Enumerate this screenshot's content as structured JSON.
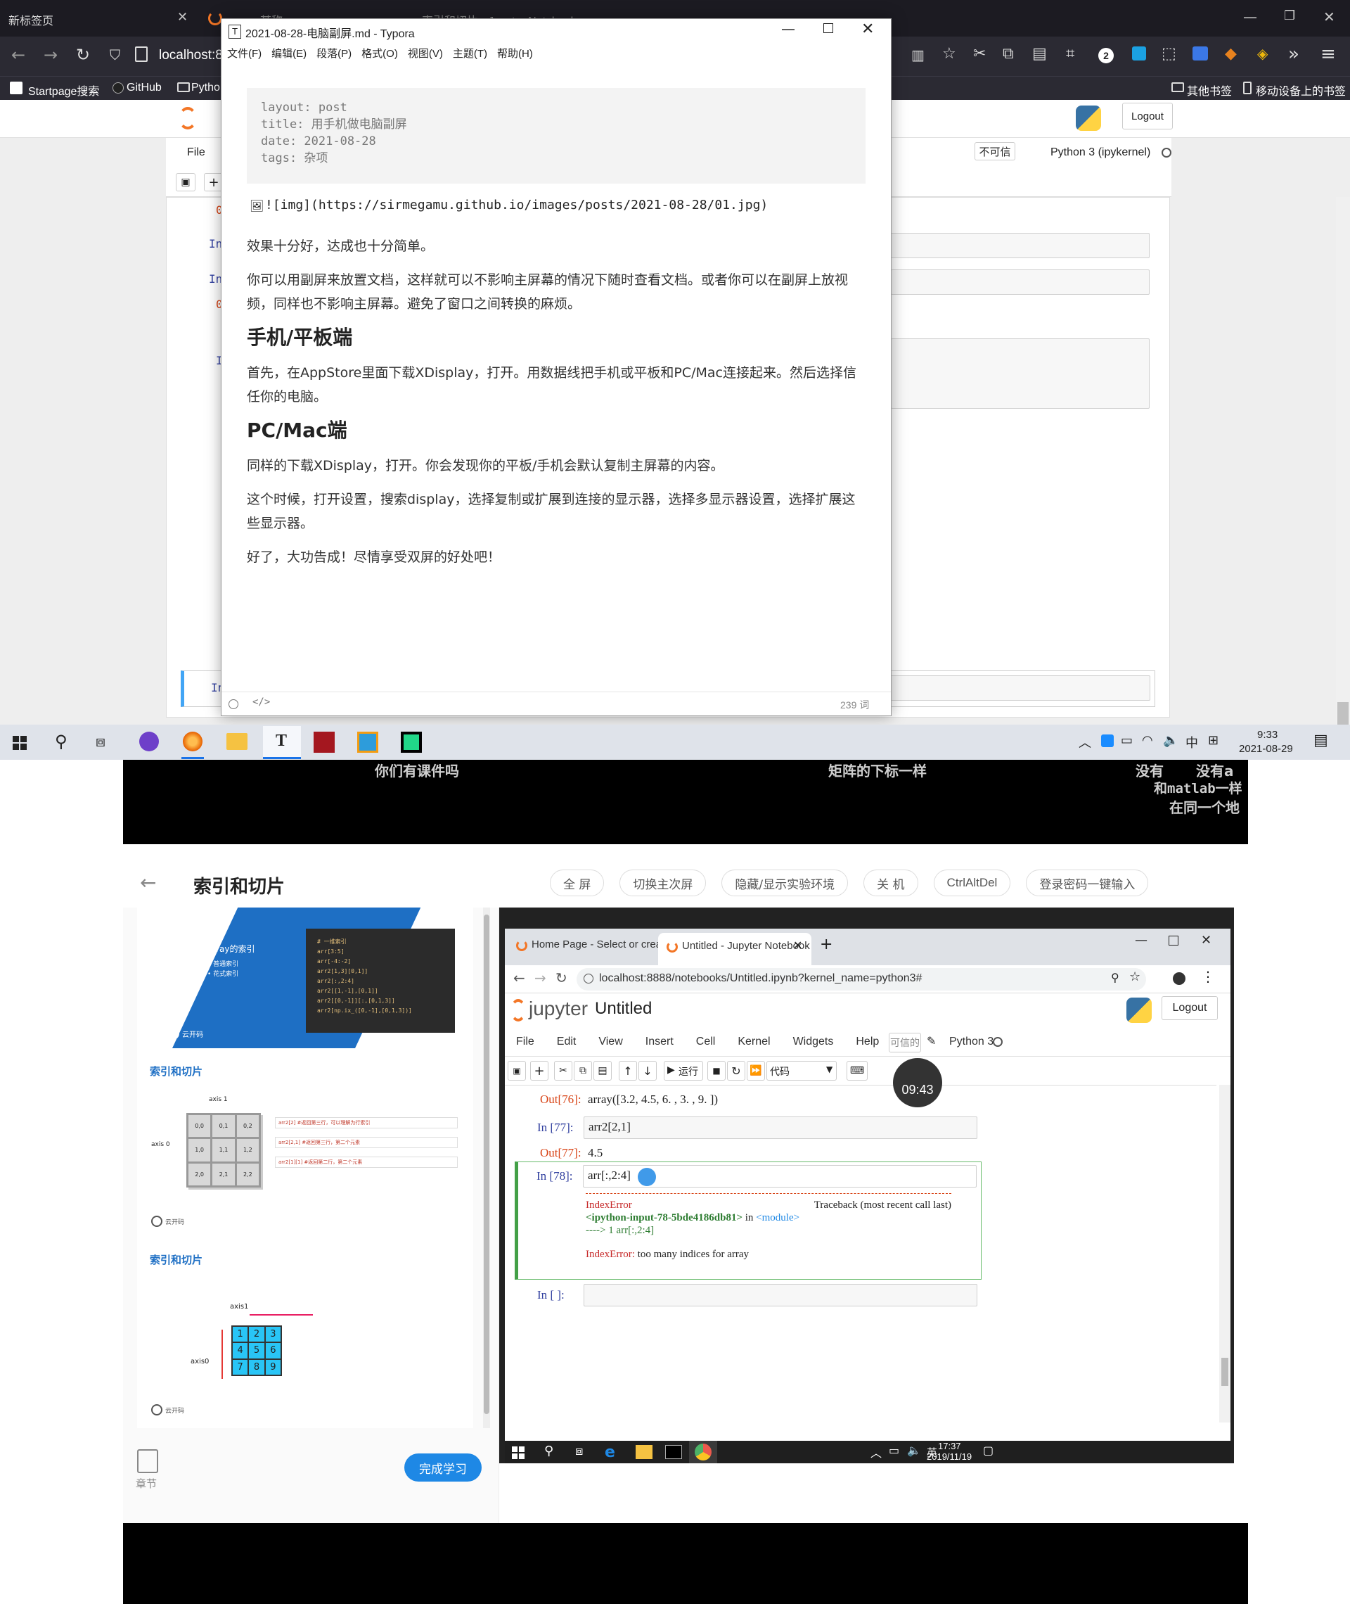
{
  "browser": {
    "tabs": [
      "新标签页",
      "某称",
      "索引和切片 - Jupyter Notebook"
    ],
    "address": "localhost:8",
    "bookmarks": [
      "Startpage搜索",
      "GitHub",
      "Pytho"
    ],
    "bookmarks_right": [
      "其他书签",
      "移动设备上的书签"
    ],
    "ext_badge": "2"
  },
  "jupyter_bg": {
    "logout": "Logout",
    "menu_file": "File",
    "not_trusted": "不可信",
    "kernel": "Python 3 (ipykernel)",
    "in_prompts": [
      "In",
      "In",
      "I",
      "In"
    ],
    "out_prompts": [
      "0",
      "0"
    ]
  },
  "typora": {
    "title": "2021-08-28-电脑副屏.md - Typora",
    "menu": [
      "文件(F)",
      "编辑(E)",
      "段落(P)",
      "格式(O)",
      "视图(V)",
      "主题(T)",
      "帮助(H)"
    ],
    "frontmatter": [
      "layout: post",
      "title: 用手机做电脑副屏",
      "date: 2021-08-28",
      "tags: 杂项"
    ],
    "img_md": "![img](https://sirmegamu.github.io/images/posts/2021-08-28/01.jpg)",
    "p1": "效果十分好，达成也十分简单。",
    "p2": "你可以用副屏来放置文档，这样就可以不影响主屏幕的情况下随时查看文档。或者你可以在副屏上放视频，同样也不影响主屏幕。避免了窗口之间转换的麻烦。",
    "h1": "手机/平板端",
    "p3": "首先，在AppStore里面下载XDisplay，打开。用数据线把手机或平板和PC/Mac连接起来。然后选择信任你的电脑。",
    "h2": "PC/Mac端",
    "p4": "同样的下载XDisplay，打开。你会发现你的平板/手机会默认复制主屏幕的内容。",
    "p5": "这个时候，打开设置，搜索display，选择复制或扩展到连接的显示器，选择多显示器设置，选择扩展这些显示器。",
    "p6": "好了，大功告成！尽情享受双屏的好处吧！",
    "word_count": "239 词"
  },
  "taskbar_top": {
    "time": "9:33",
    "date": "2021-08-29",
    "ime": "中",
    "t_label": "T"
  },
  "video": {
    "danmaku": [
      "你们有课件吗",
      "矩阵的下标一样",
      "没有",
      "没有a",
      "和matlab一样",
      "在同一个地"
    ],
    "course_title": "索引和切片",
    "toolbar": [
      "全 屏",
      "切换主次屏",
      "隐藏/显示实验环境",
      "关 机",
      "CtrlAltDel",
      "登录密码一键输入"
    ],
    "slide1_title": "array的索引",
    "slide1_bullets": [
      "• 普通索引",
      "• 花式索引"
    ],
    "slide1_code": [
      "# 一维索引",
      "arr[3:5]",
      "arr[-4:-2]",
      "arr2[1,3][0,1]]",
      "arr2[:,2:4]",
      "arr2[[1,-1],[0,1]]",
      "arr2[[0,-1]][:,[0,1,3]]",
      "arr2[np.ix_([0,-1],[0,1,3])]"
    ],
    "brand": "云开码",
    "section1": "索引和切片",
    "section2": "索引和切片",
    "grid1_axis1": "axis 1",
    "grid1_axis0": "axis 0",
    "grid1_cells": [
      "0,0",
      "0,1",
      "0,2",
      "1,0",
      "1,1",
      "1,2",
      "2,0",
      "2,1",
      "2,2"
    ],
    "grid1_notes": [
      "arr2[2]  #返回第三行，可以理解为行索引",
      "arr2[2,1]  #返回第三行，第二个元素",
      "arr2[1][1]  #返回第二行，第二个元素"
    ],
    "grid2_axis1": "axis1",
    "grid2_axis0": "axis0",
    "grid2_cells": [
      "1",
      "2",
      "3",
      "4",
      "5",
      "6",
      "7",
      "8",
      "9"
    ],
    "nav_label": "章节",
    "finish_btn": "完成学习"
  },
  "remote": {
    "tabs": [
      "Home Page - Select or create",
      "Untitled - Jupyter Notebook"
    ],
    "url": "localhost:8888/notebooks/Untitled.ipynb?kernel_name=python3#",
    "logo_text": "jupyter",
    "nb_title": "Untitled",
    "logout": "Logout",
    "menu": [
      "File",
      "Edit",
      "View",
      "Insert",
      "Cell",
      "Kernel",
      "Widgets",
      "Help"
    ],
    "trusted": "可信的",
    "kernel": "Python 3",
    "run_label": "运行",
    "cell_type": "代码",
    "timer": "09:43",
    "cells": {
      "out76_prompt": "Out[76]:",
      "out76": "array([3.2, 4.5, 6. , 3. , 9. ])",
      "in77_prompt": "In  [77]:",
      "in77": "arr2[2,1]",
      "out77_prompt": "Out[77]:",
      "out77": "4.5",
      "in78_prompt": "In  [78]:",
      "in78": "arr[:,2:4]",
      "err_name": "IndexError",
      "traceback": "Traceback (most recent call last)",
      "err_line2a": "<ipython-input-78-5bde4186db81>",
      "err_line2b": " in ",
      "err_line2c": "<module>",
      "err_line3": "----> 1 arr[:,2:4]",
      "err_last_name": "IndexError:",
      "err_last_msg": " too many indices for array",
      "in_empty_prompt": "In  [ ]:"
    },
    "taskbar_time": "17:37",
    "taskbar_date": "2019/11/19",
    "ime": "英"
  }
}
